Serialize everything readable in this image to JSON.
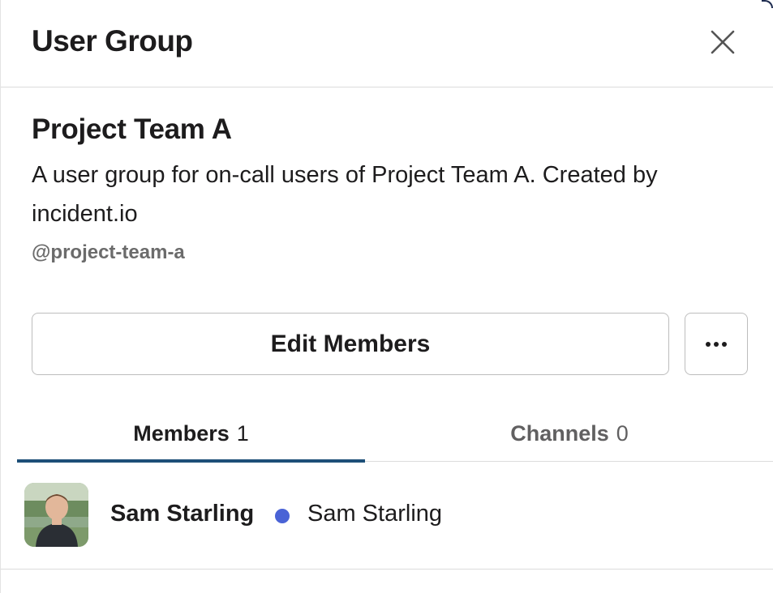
{
  "header": {
    "title": "User Group",
    "close_icon": "close-icon"
  },
  "group": {
    "name": "Project Team A",
    "description": "A user group for on-call users of Project Team A. Created by incident.io",
    "handle": "@project-team-a"
  },
  "actions": {
    "edit_members_label": "Edit Members",
    "more_icon": "more-horizontal-icon"
  },
  "tabs": [
    {
      "label": "Members",
      "count": "1",
      "active": true
    },
    {
      "label": "Channels",
      "count": "0",
      "active": false
    }
  ],
  "members": [
    {
      "name": "Sam Starling",
      "display_name": "Sam Starling",
      "status_color": "#4a63d6",
      "avatar_icon": "avatar-photo"
    }
  ],
  "colors": {
    "active_tab_underline": "#1d4f78",
    "status_active": "#4a63d6"
  }
}
